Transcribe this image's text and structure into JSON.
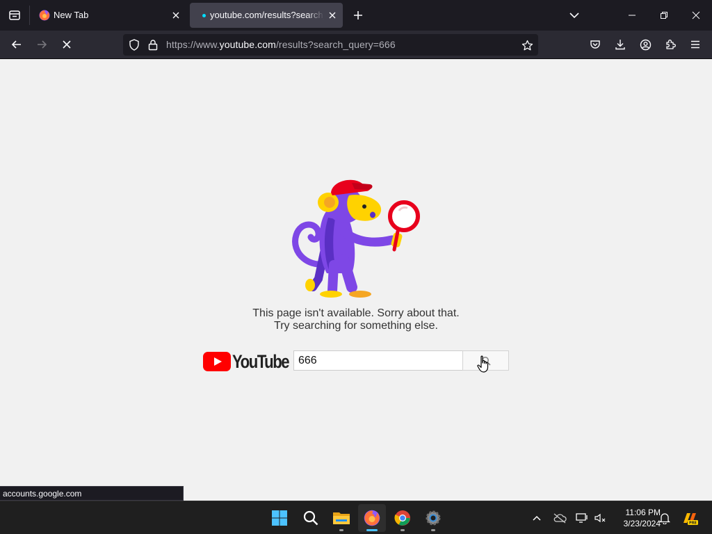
{
  "browser": {
    "tabs": [
      {
        "title": "New Tab",
        "active": false
      },
      {
        "title": "youtube.com/results?search_query=666",
        "active": true
      }
    ],
    "url": {
      "prefix": "https://www.",
      "host": "youtube.com",
      "path": "/results?search_query=666"
    },
    "status_text": "accounts.google.com"
  },
  "page": {
    "error_line1": "This page isn't available. Sorry about that.",
    "error_line2": "Try searching for something else.",
    "logo_text": "YouTube",
    "search_value": "666"
  },
  "taskbar": {
    "apps": [
      "windows-start",
      "search",
      "file-explorer",
      "firefox",
      "chrome",
      "settings"
    ],
    "active_app": "firefox",
    "time": "11:06 PM",
    "date": "3/23/2024"
  },
  "colors": {
    "youtube_red": "#ff0000",
    "loading_accent": "#00ddff",
    "page_bg": "#f1f1f1",
    "taskbar_accent": "#4cc2ff"
  }
}
